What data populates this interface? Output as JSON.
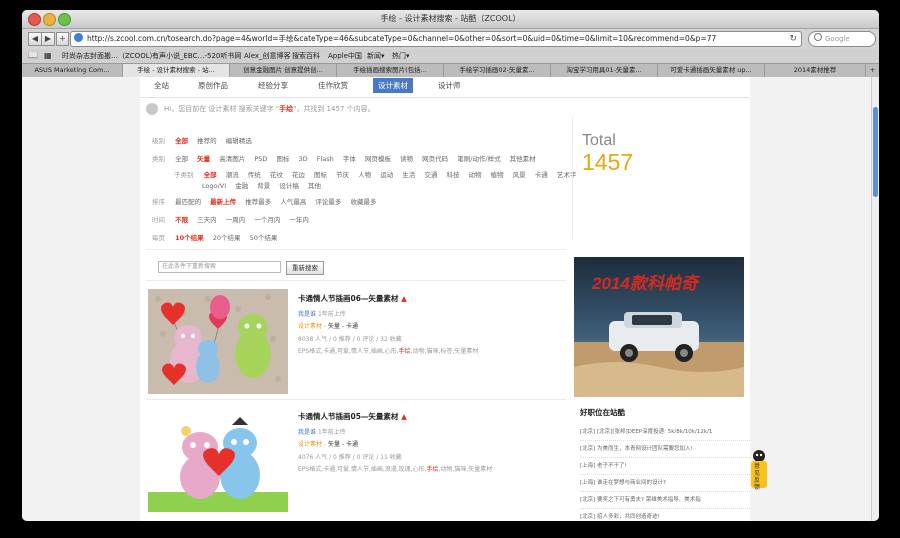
{
  "window": {
    "title": "手绘 - 设计素材搜索 - 站酷（ZCOOL）"
  },
  "toolbar": {
    "back": "◀",
    "forward": "▶",
    "add": "+",
    "url": "http://s.zcool.com.cn/tosearch.do?page=4&world=手绘&cateType=46&subcateType=0&channel=0&other=0&sort=0&uid=0&time=0&limit=10&recommend=0&p=77",
    "refresh": "↻",
    "search_placeholder": "Google"
  },
  "bookmarks": [
    "时尚杂志封面搬…（ZCOOL）",
    "有声小说_EBC…-520听书网",
    "Alex_创意博客",
    "搜索百科",
    "Apple中国",
    "新闻▾",
    "热门▾"
  ],
  "tabs": [
    {
      "label": "ASUS Marketing Com..."
    },
    {
      "label": "手绘 - 设计素材搜索 - 站..."
    },
    {
      "label": "创意金融图片 创意提供创..."
    },
    {
      "label": "手绘插画搜索图片(包括..."
    },
    {
      "label": "手绘学习插画02-矢量素..."
    },
    {
      "label": "淘宝学习用具01-矢量素..."
    },
    {
      "label": "可爱卡通插画矢量素材 up..."
    },
    {
      "label": "2014素材推荐"
    }
  ],
  "nav": [
    "全站",
    "原创作品",
    "经验分享",
    "佳作欣赏",
    "设计素材",
    "设计师"
  ],
  "hi": {
    "prefix": "Hi，您目前在 设计素材 搜索关键字 \"",
    "keyword": "手绘",
    "suffix": "\"，共找到 1457 个内容。"
  },
  "filters": {
    "level": {
      "label": "级别",
      "items": [
        "全部",
        "推荐的",
        "编辑精选"
      ],
      "active": "全部"
    },
    "category": {
      "label": "类别",
      "items": [
        "全部",
        "矢量",
        "高清图片",
        "PSD",
        "图标",
        "3D",
        "Flash",
        "字体",
        "网页模板",
        "读物",
        "网页代码",
        "笔刷/动作/样式",
        "其他素材"
      ],
      "active": "矢量"
    },
    "subcategory": {
      "label": "子类别",
      "items": [
        "全部",
        "潮流",
        "传统",
        "花纹",
        "花边",
        "图标",
        "节庆",
        "人物",
        "运动",
        "生活",
        "交通",
        "科技",
        "动物",
        "植物",
        "风景",
        "卡通",
        "艺术字"
      ],
      "active": "全部",
      "items2": [
        "Logo/VI",
        "金融",
        "背景",
        "设计稿",
        "其他"
      ]
    },
    "sort": {
      "label": "排序",
      "items": [
        "最匹配的",
        "最新上传",
        "推荐最多",
        "人气最高",
        "评论最多",
        "收藏最多"
      ],
      "active": "最新上传"
    },
    "time": {
      "label": "时间",
      "items": [
        "不限",
        "三天内",
        "一周内",
        "一个月内",
        "一年内"
      ],
      "active": "不限"
    },
    "perpage": {
      "label": "每页",
      "items": [
        "10个结果",
        "20个结果",
        "50个结果"
      ],
      "active": "10个结果"
    }
  },
  "search_box": {
    "placeholder": "在此条件下重新搜索",
    "button": "重新搜索"
  },
  "total": {
    "label": "Total",
    "value": "1457"
  },
  "results": [
    {
      "title": "卡通情人节插画06—矢量素材",
      "author": "我是谁",
      "time": "1年前上传",
      "category": "设计素材",
      "tags": "矢量 - 卡通",
      "stats": "8038 人气 / 0 推荐 / 0 评论 / 32 收藏",
      "keywords": "EPS格式,卡通,可爱,情人节,插画,心形,手绘,动物,猫咪,标签,矢量素材",
      "keyword_highlight": "手绘"
    },
    {
      "title": "卡通情人节插画05—矢量素材",
      "author": "我是谁",
      "time": "1年前上传",
      "category": "设计素材",
      "tags": "矢量 - 卡通",
      "stats": "4076 人气 / 0 推荐 / 0 评论 / 11 收藏",
      "keywords": "EPS格式,卡通,可爱,情人节,插画,浪漫,玫瑰,心形,手绘,动物,猫咪,矢量素材",
      "keyword_highlight": "手绘"
    }
  ],
  "ad": {
    "headline": "2014款科帕奇"
  },
  "jobs": {
    "title": "好职位在站酷",
    "items": [
      "[北京] [北京][张邦]DEEP深度投递: 5k/8k/10k/12k/1",
      "[北京] 为美而生，本青网设计团队需要您加入!",
      "[上海] 老子不干了!",
      "[上海] 谁走在梦想与商业间的设计?",
      "[北京] 要奖之下可有勇夫? 荣维美术指导、美术指",
      "[北京] 招人多彩，共同创造奇迹!"
    ]
  },
  "feedback": {
    "label": "意见反馈"
  },
  "colors": {
    "accent": "#e0301e",
    "link": "#3b74c8",
    "total": "#e6a90b",
    "nav_active": "#4a79c8"
  }
}
